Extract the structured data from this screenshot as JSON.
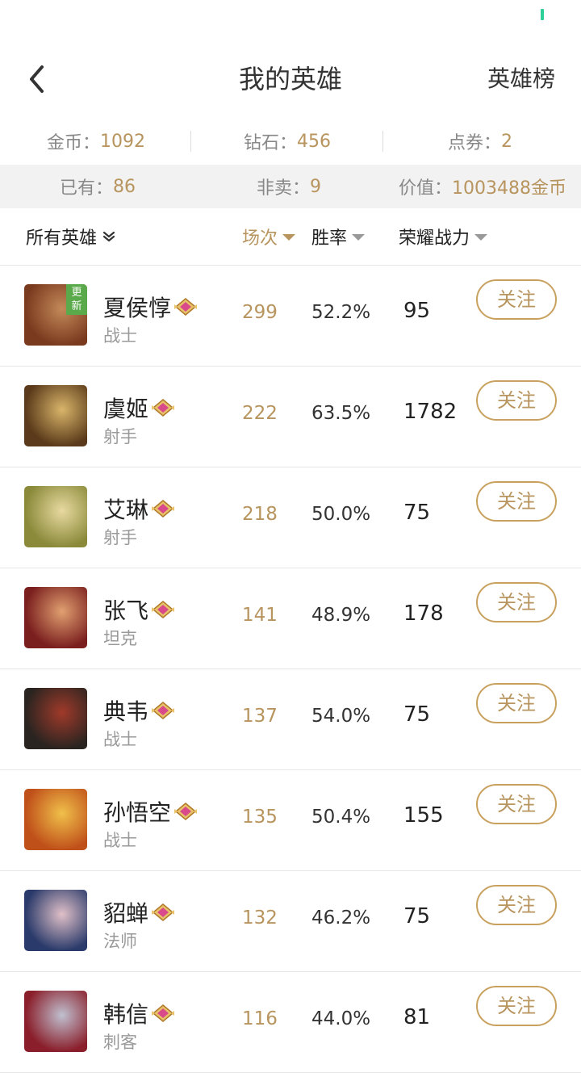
{
  "nav": {
    "title": "我的英雄",
    "right_label": "英雄榜"
  },
  "stats_row1": [
    {
      "label": "金币：",
      "value": "1092"
    },
    {
      "label": "钻石：",
      "value": "456"
    },
    {
      "label": "点券：",
      "value": "2"
    }
  ],
  "stats_row2": [
    {
      "label": "已有：",
      "value": "86"
    },
    {
      "label": "非卖：",
      "value": "9"
    },
    {
      "label": "价值：",
      "value": "1003488金币"
    }
  ],
  "columns": {
    "filter": "所有英雄",
    "games": "场次",
    "winrate": "胜率",
    "power": "荣耀战力"
  },
  "heroes": [
    {
      "name": "夏侯惇",
      "role": "战士",
      "games": "299",
      "winrate": "52.2%",
      "power": "95",
      "badge": "更新",
      "follow": "关注",
      "avatar_colors": [
        "#7a3a1e",
        "#c48a5a"
      ]
    },
    {
      "name": "虞姬",
      "role": "射手",
      "games": "222",
      "winrate": "63.5%",
      "power": "1782",
      "badge": "",
      "follow": "关注",
      "avatar_colors": [
        "#5a3a1a",
        "#d9b56a"
      ]
    },
    {
      "name": "艾琳",
      "role": "射手",
      "games": "218",
      "winrate": "50.0%",
      "power": "75",
      "badge": "",
      "follow": "关注",
      "avatar_colors": [
        "#8a8a3a",
        "#e8d9a0"
      ]
    },
    {
      "name": "张飞",
      "role": "坦克",
      "games": "141",
      "winrate": "48.9%",
      "power": "178",
      "badge": "",
      "follow": "关注",
      "avatar_colors": [
        "#7a1e1e",
        "#e0a070"
      ]
    },
    {
      "name": "典韦",
      "role": "战士",
      "games": "137",
      "winrate": "54.0%",
      "power": "75",
      "badge": "",
      "follow": "关注",
      "avatar_colors": [
        "#2a2420",
        "#a03a2a"
      ]
    },
    {
      "name": "孙悟空",
      "role": "战士",
      "games": "135",
      "winrate": "50.4%",
      "power": "155",
      "badge": "",
      "follow": "关注",
      "avatar_colors": [
        "#c0501a",
        "#f0c04a"
      ]
    },
    {
      "name": "貂蝉",
      "role": "法师",
      "games": "132",
      "winrate": "46.2%",
      "power": "75",
      "badge": "",
      "follow": "关注",
      "avatar_colors": [
        "#2a3a6a",
        "#e0c0c8"
      ]
    },
    {
      "name": "韩信",
      "role": "刺客",
      "games": "116",
      "winrate": "44.0%",
      "power": "81",
      "badge": "",
      "follow": "关注",
      "avatar_colors": [
        "#8a1e2a",
        "#c0c0d0"
      ]
    }
  ],
  "colors": {
    "accent": "#b8945e",
    "badge_green": "#5aa94a",
    "status_indicator": "#2fcf9a"
  }
}
